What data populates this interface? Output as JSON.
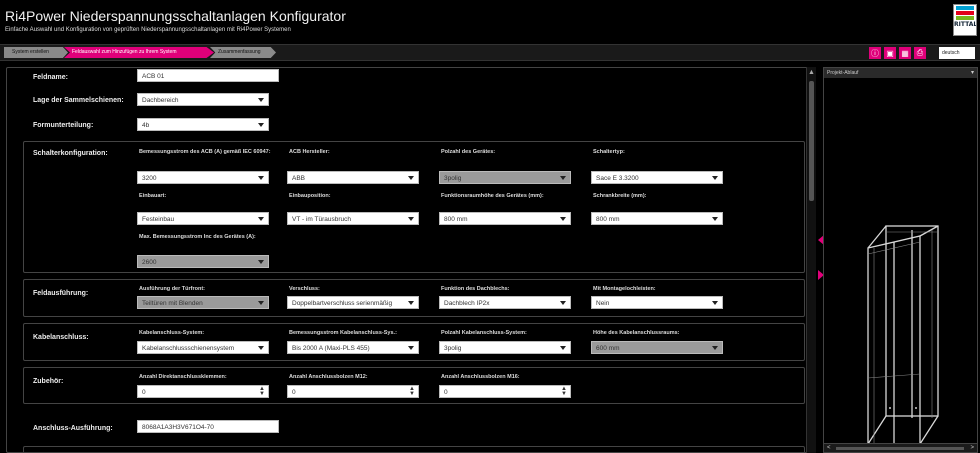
{
  "header": {
    "title": "Ri4Power Niederspannungsschaltanlagen Konfigurator",
    "subtitle": "Einfache Auswahl und Konfiguration von geprüften Niederspannungsschaltanlagen mit Ri4Power Systemen",
    "logo_text": "RITTAL",
    "logo_colors": [
      "#00a0d2",
      "#e3001b",
      "#7ab51d",
      "#ffcc00"
    ]
  },
  "nav": {
    "steps": [
      {
        "label": "System erstellen",
        "state": "done"
      },
      {
        "label": "Feldauswahl zum Hinzufügen zu Ihrem System",
        "state": "active"
      },
      {
        "label": "Zusammenfassung",
        "state": "todo"
      }
    ],
    "tools": [
      "info-icon",
      "folder-icon",
      "save-icon",
      "print-icon"
    ],
    "language": "deutsch",
    "accent_color": "#e0007a"
  },
  "form": {
    "feldname": {
      "label": "Feldname:",
      "value": "ACB 01"
    },
    "lage": {
      "label": "Lage der Sammelschienen:",
      "value": "Dachbereich"
    },
    "formunterteilung": {
      "label": "Formunterteilung:",
      "value": "4b"
    },
    "schalter": {
      "label": "Schalterkonfiguration:",
      "bemessungsstrom": {
        "label": "Bemessungsstrom des ACB (A) gemäß IEC 60947:",
        "value": "3200"
      },
      "hersteller": {
        "label": "ACB Hersteller:",
        "value": "ABB"
      },
      "polzahl": {
        "label": "Polzahl des Gerätes:",
        "value": "3polig"
      },
      "schaltertyp": {
        "label": "Schaltertyp:",
        "value": "Sace E 3.3200"
      },
      "einbauart": {
        "label": "Einbauart:",
        "value": "Festeinbau"
      },
      "einbauposition": {
        "label": "Einbauposition:",
        "value": "VT - im Türausbruch"
      },
      "funktionsraumhoehe": {
        "label": "Funktionsraumhöhe des Gerätes (mm):",
        "value": "800 mm"
      },
      "schrankbreite": {
        "label": "Schrankbreite (mm):",
        "value": "800 mm"
      },
      "max_strom": {
        "label": "Max. Bemessungsstrom Inc des Gerätes (A):",
        "value": "2600"
      }
    },
    "feldausfuehrung": {
      "label": "Feldausführung:",
      "tuerfront": {
        "label": "Ausführung der Türfront:",
        "value": "Teiltüren mit Blenden"
      },
      "verschluss": {
        "label": "Verschluss:",
        "value": "Doppelbartverschluss serienmäßig"
      },
      "dachblech": {
        "label": "Funktion des Dachblechs:",
        "value": "Dachblech IP2x"
      },
      "montage": {
        "label": "Mit Montagelochleisten:",
        "value": "Nein"
      }
    },
    "kabelanschluss": {
      "label": "Kabelanschluss:",
      "system": {
        "label": "Kabelanschluss-System:",
        "value": "Kabelanschlussschienensystem"
      },
      "strom": {
        "label": "Bemessungsstrom Kabelanschluss-Sys.:",
        "value": "Bis 2000 A (Maxi-PLS 455)"
      },
      "polzahl": {
        "label": "Polzahl Kabelanschluss-System:",
        "value": "3polig"
      },
      "hoehe": {
        "label": "Höhe des Kabelanschlussraums:",
        "value": "600 mm"
      }
    },
    "zubehoer": {
      "label": "Zubehör:",
      "direkt": {
        "label": "Anzahl Direktanschlussklemmen:",
        "value": "0"
      },
      "m12": {
        "label": "Anzahl Anschlussbolzen M12:",
        "value": "0"
      },
      "m16": {
        "label": "Anzahl Anschlussbolzen M16:",
        "value": "0"
      }
    },
    "anschluss": {
      "label": "Anschluss-Ausführung:",
      "value": "8068A1A3H3V671O4-70"
    }
  },
  "side": {
    "title": "Projekt-Ablauf"
  }
}
